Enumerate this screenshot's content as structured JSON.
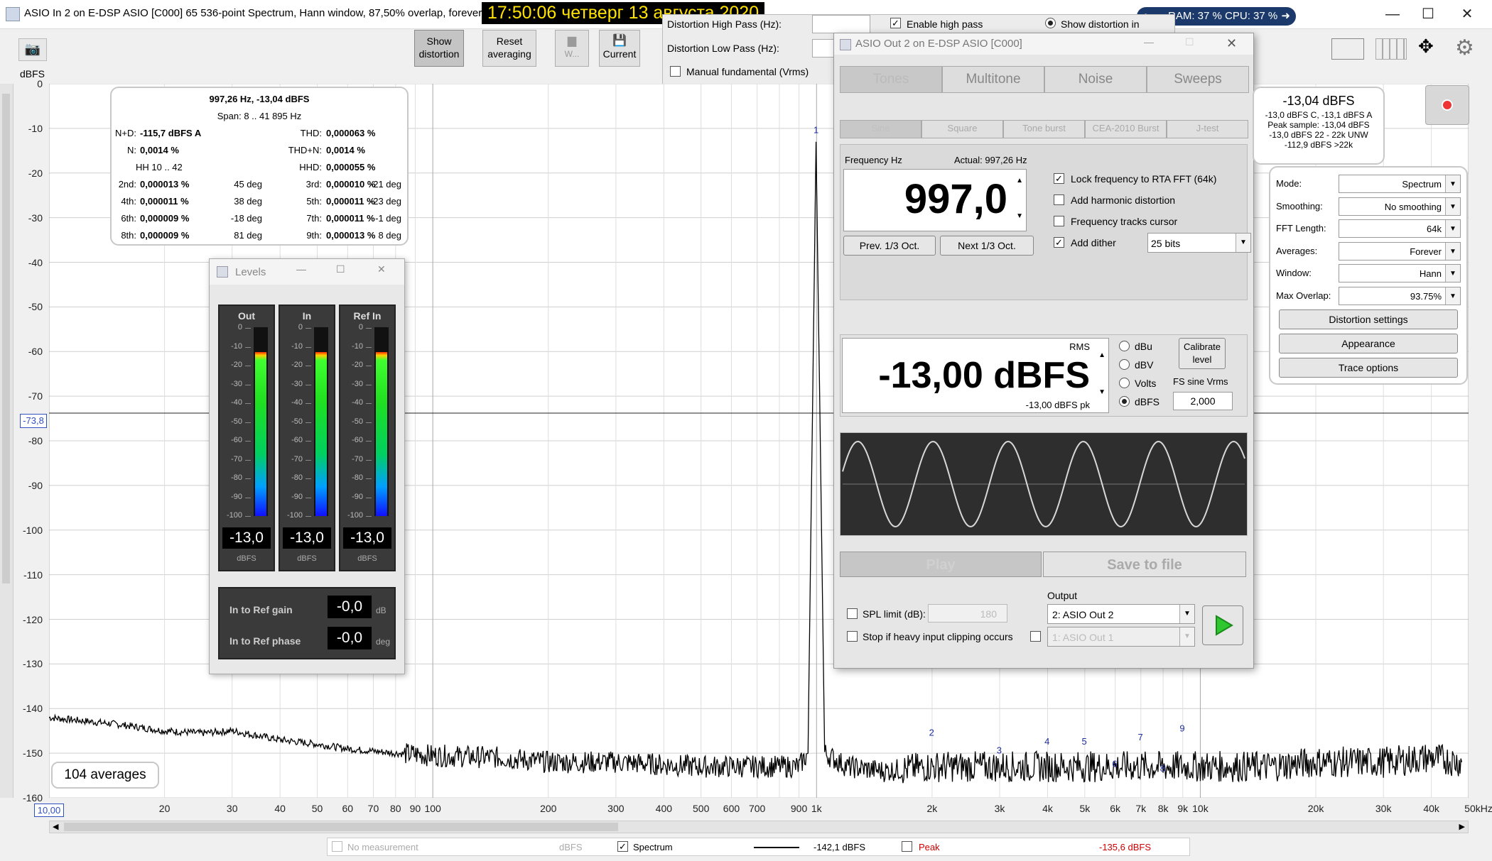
{
  "window": {
    "title": "ASIO In 2 on E-DSP ASIO [C000] 65 536-point Spectrum, Hann window, 87,50% overlap, forever av",
    "clock": "17:50:06  четверг 13 августа 2020",
    "sysmon": "RAM: 37 %  CPU: 37 %"
  },
  "toolbar": {
    "show_distortion": "Show distortion",
    "reset_averaging": "Reset averaging",
    "w_label": "W...",
    "current_label": "Current"
  },
  "hp_panel": {
    "dist_high_pass": "Distortion High Pass (Hz):",
    "dist_low_pass": "Distortion Low Pass (Hz):",
    "manual_fundamental": "Manual fundamental (Vrms)",
    "enable_high_pass": "Enable high pass",
    "show_distortion_in": "Show distortion in"
  },
  "plot": {
    "yunit": "dBFS",
    "yticks": [
      "0",
      "-10",
      "-20",
      "-30",
      "-40",
      "-50",
      "-60",
      "-70",
      "-80",
      "-90",
      "-100",
      "-110",
      "-120",
      "-130",
      "-140",
      "-150",
      "-160"
    ],
    "cursor_label": "-73,8",
    "xticks": [
      "20",
      "30",
      "40",
      "50",
      "60",
      "70",
      "80",
      "90",
      "100",
      "200",
      "300",
      "400",
      "500",
      "600",
      "700",
      "900",
      "1k",
      "2k",
      "3k",
      "4k",
      "5k",
      "6k",
      "7k",
      "8k",
      "9k",
      "10k",
      "20k",
      "30k",
      "40k",
      "50kHz"
    ],
    "xstart": "10,00",
    "averages": "104 averages",
    "harmonic_markers": [
      "1",
      "2",
      "3",
      "4",
      "5",
      "6",
      "7",
      "8",
      "9"
    ]
  },
  "chart_data": {
    "type": "line",
    "title": "",
    "xlabel": "",
    "ylabel": "dBFS",
    "xscale": "log",
    "xlim": [
      10,
      50000
    ],
    "ylim": [
      -160,
      0
    ],
    "series": [
      {
        "name": "Spectrum",
        "x": [
          10,
          15,
          20,
          25,
          30,
          40,
          50,
          60,
          80,
          100,
          150,
          200,
          300,
          500,
          700,
          900,
          950,
          997,
          1050,
          1200,
          1500,
          2000,
          2500,
          3000,
          4000,
          5000,
          6000,
          7000,
          8000,
          9000,
          10000,
          15000,
          20000,
          30000,
          40000,
          48000
        ],
        "y": [
          -142,
          -143.5,
          -145,
          -145.5,
          -145,
          -147,
          -148,
          -149,
          -150,
          -150.5,
          -151,
          -152,
          -152,
          -153,
          -153,
          -153,
          -150,
          -13,
          -150,
          -153,
          -154,
          -153,
          -153,
          -153,
          -153,
          -153,
          -153,
          -153,
          -153,
          -153,
          -153,
          -153,
          -152,
          -152,
          -151,
          -152
        ]
      }
    ],
    "peaks": [
      {
        "label": "1",
        "x": 997,
        "y": -13
      },
      {
        "label": "2",
        "x": 1994,
        "y": -148
      },
      {
        "label": "3",
        "x": 2991,
        "y": -152
      },
      {
        "label": "4",
        "x": 3988,
        "y": -150
      },
      {
        "label": "5",
        "x": 4985,
        "y": -150
      },
      {
        "label": "6",
        "x": 5982,
        "y": -155
      },
      {
        "label": "7",
        "x": 6979,
        "y": -149
      },
      {
        "label": "8",
        "x": 7976,
        "y": -156
      },
      {
        "label": "9",
        "x": 8973,
        "y": -147
      }
    ]
  },
  "dist_panel": {
    "header": "997,26 Hz, -13,04 dBFS",
    "span": "Span: 8 .. 41 895 Hz",
    "nd_label": "N+D:",
    "nd_value": "-115,7 dBFS A",
    "thd_label": "THD:",
    "thd_value": "0,000063 %",
    "n_label": "N:",
    "n_value": "0,0014 %",
    "thdn_label": "THD+N:",
    "thdn_value": "0,0014 %",
    "hh_label": "HH 10 .. 42",
    "hhd_label": "HHD:",
    "hhd_value": "0,000055 %",
    "rows": [
      {
        "a": "2nd:",
        "av": "0,000013 %",
        "ad": "45 deg",
        "b": "3rd:",
        "bv": "0,000010 %",
        "bd": "-21 deg"
      },
      {
        "a": "4th:",
        "av": "0,000011 %",
        "ad": "38 deg",
        "b": "5th:",
        "bv": "0,000011 %",
        "bd": "-23 deg"
      },
      {
        "a": "6th:",
        "av": "0,000009 %",
        "ad": "-18 deg",
        "b": "7th:",
        "bv": "0,000011 %",
        "bd": "-1 deg"
      },
      {
        "a": "8th:",
        "av": "0,000009 %",
        "ad": "81 deg",
        "b": "9th:",
        "bv": "0,000013 %",
        "bd": "8 deg"
      }
    ]
  },
  "levels": {
    "title": "Levels",
    "meters": [
      {
        "name": "Out",
        "value": "-13,0",
        "unit": "dBFS"
      },
      {
        "name": "In",
        "value": "-13,0",
        "unit": "dBFS"
      },
      {
        "name": "Ref In",
        "value": "-13,0",
        "unit": "dBFS"
      }
    ],
    "scale": [
      "0",
      "-10",
      "-20",
      "-30",
      "-40",
      "-50",
      "-60",
      "-70",
      "-80",
      "-90",
      "-100"
    ],
    "gain_label": "In to Ref gain",
    "gain_value": "-0,0",
    "gain_unit": "dB",
    "phase_label": "In to Ref phase",
    "phase_value": "-0,0",
    "phase_unit": "deg"
  },
  "generator": {
    "title": "ASIO Out 2 on E-DSP ASIO [C000]",
    "tabs": [
      "Tones",
      "Multitone",
      "Noise",
      "Sweeps"
    ],
    "subtabs": [
      "Sine",
      "Square",
      "Tone burst",
      "CEA-2010 Burst",
      "J-test"
    ],
    "freq_label": "Frequency Hz",
    "actual": "Actual: 997,26 Hz",
    "freq_value": "997,0",
    "prev_oct": "Prev. 1/3 Oct.",
    "next_oct": "Next 1/3 Oct.",
    "lock_freq": "Lock frequency to RTA FFT (64k)",
    "add_harmonic": "Add harmonic distortion",
    "freq_tracks": "Frequency tracks cursor",
    "add_dither": "Add dither",
    "dither_bits": "25 bits",
    "rms_label": "RMS",
    "level_value": "-13,00 dBFS",
    "level_pk": "-13,00 dBFS pk",
    "units": [
      "dBu",
      "dBV",
      "Volts",
      "dBFS"
    ],
    "calibrate": "Calibrate level",
    "fs_sine": "FS sine Vrms",
    "fs_value": "2,000",
    "play": "Play",
    "save": "Save to file",
    "spl_limit": "SPL limit (dB):",
    "spl_value": "180",
    "stop_clip": "Stop if heavy input clipping occurs",
    "output_label": "Output",
    "output_value": "2: ASIO Out 2",
    "output2_value": "1: ASIO Out 1"
  },
  "readout": {
    "main": "-13,04 dBFS",
    "l1": "-13,0 dBFS C, -13,1 dBFS A",
    "l2": "Peak sample: -13,04 dBFS",
    "l3": "-13,0 dBFS 22 - 22k UNW",
    "l4": "-112,9 dBFS >22k"
  },
  "settings": {
    "rows": [
      {
        "label": "Mode:",
        "value": "Spectrum"
      },
      {
        "label": "Smoothing:",
        "value": "No  smoothing"
      },
      {
        "label": "FFT Length:",
        "value": "64k"
      },
      {
        "label": "Averages:",
        "value": "Forever"
      },
      {
        "label": "Window:",
        "value": "Hann"
      },
      {
        "label": "Max Overlap:",
        "value": "93.75%"
      }
    ],
    "dist_settings": "Distortion settings",
    "appearance": "Appearance",
    "trace_options": "Trace options"
  },
  "status": {
    "no_measurement": "No measurement",
    "unit1": "dBFS",
    "spectrum": "Spectrum",
    "spectrum_value": "-142,1 dBFS",
    "peak": "Peak",
    "peak_value": "-135,6 dBFS"
  }
}
